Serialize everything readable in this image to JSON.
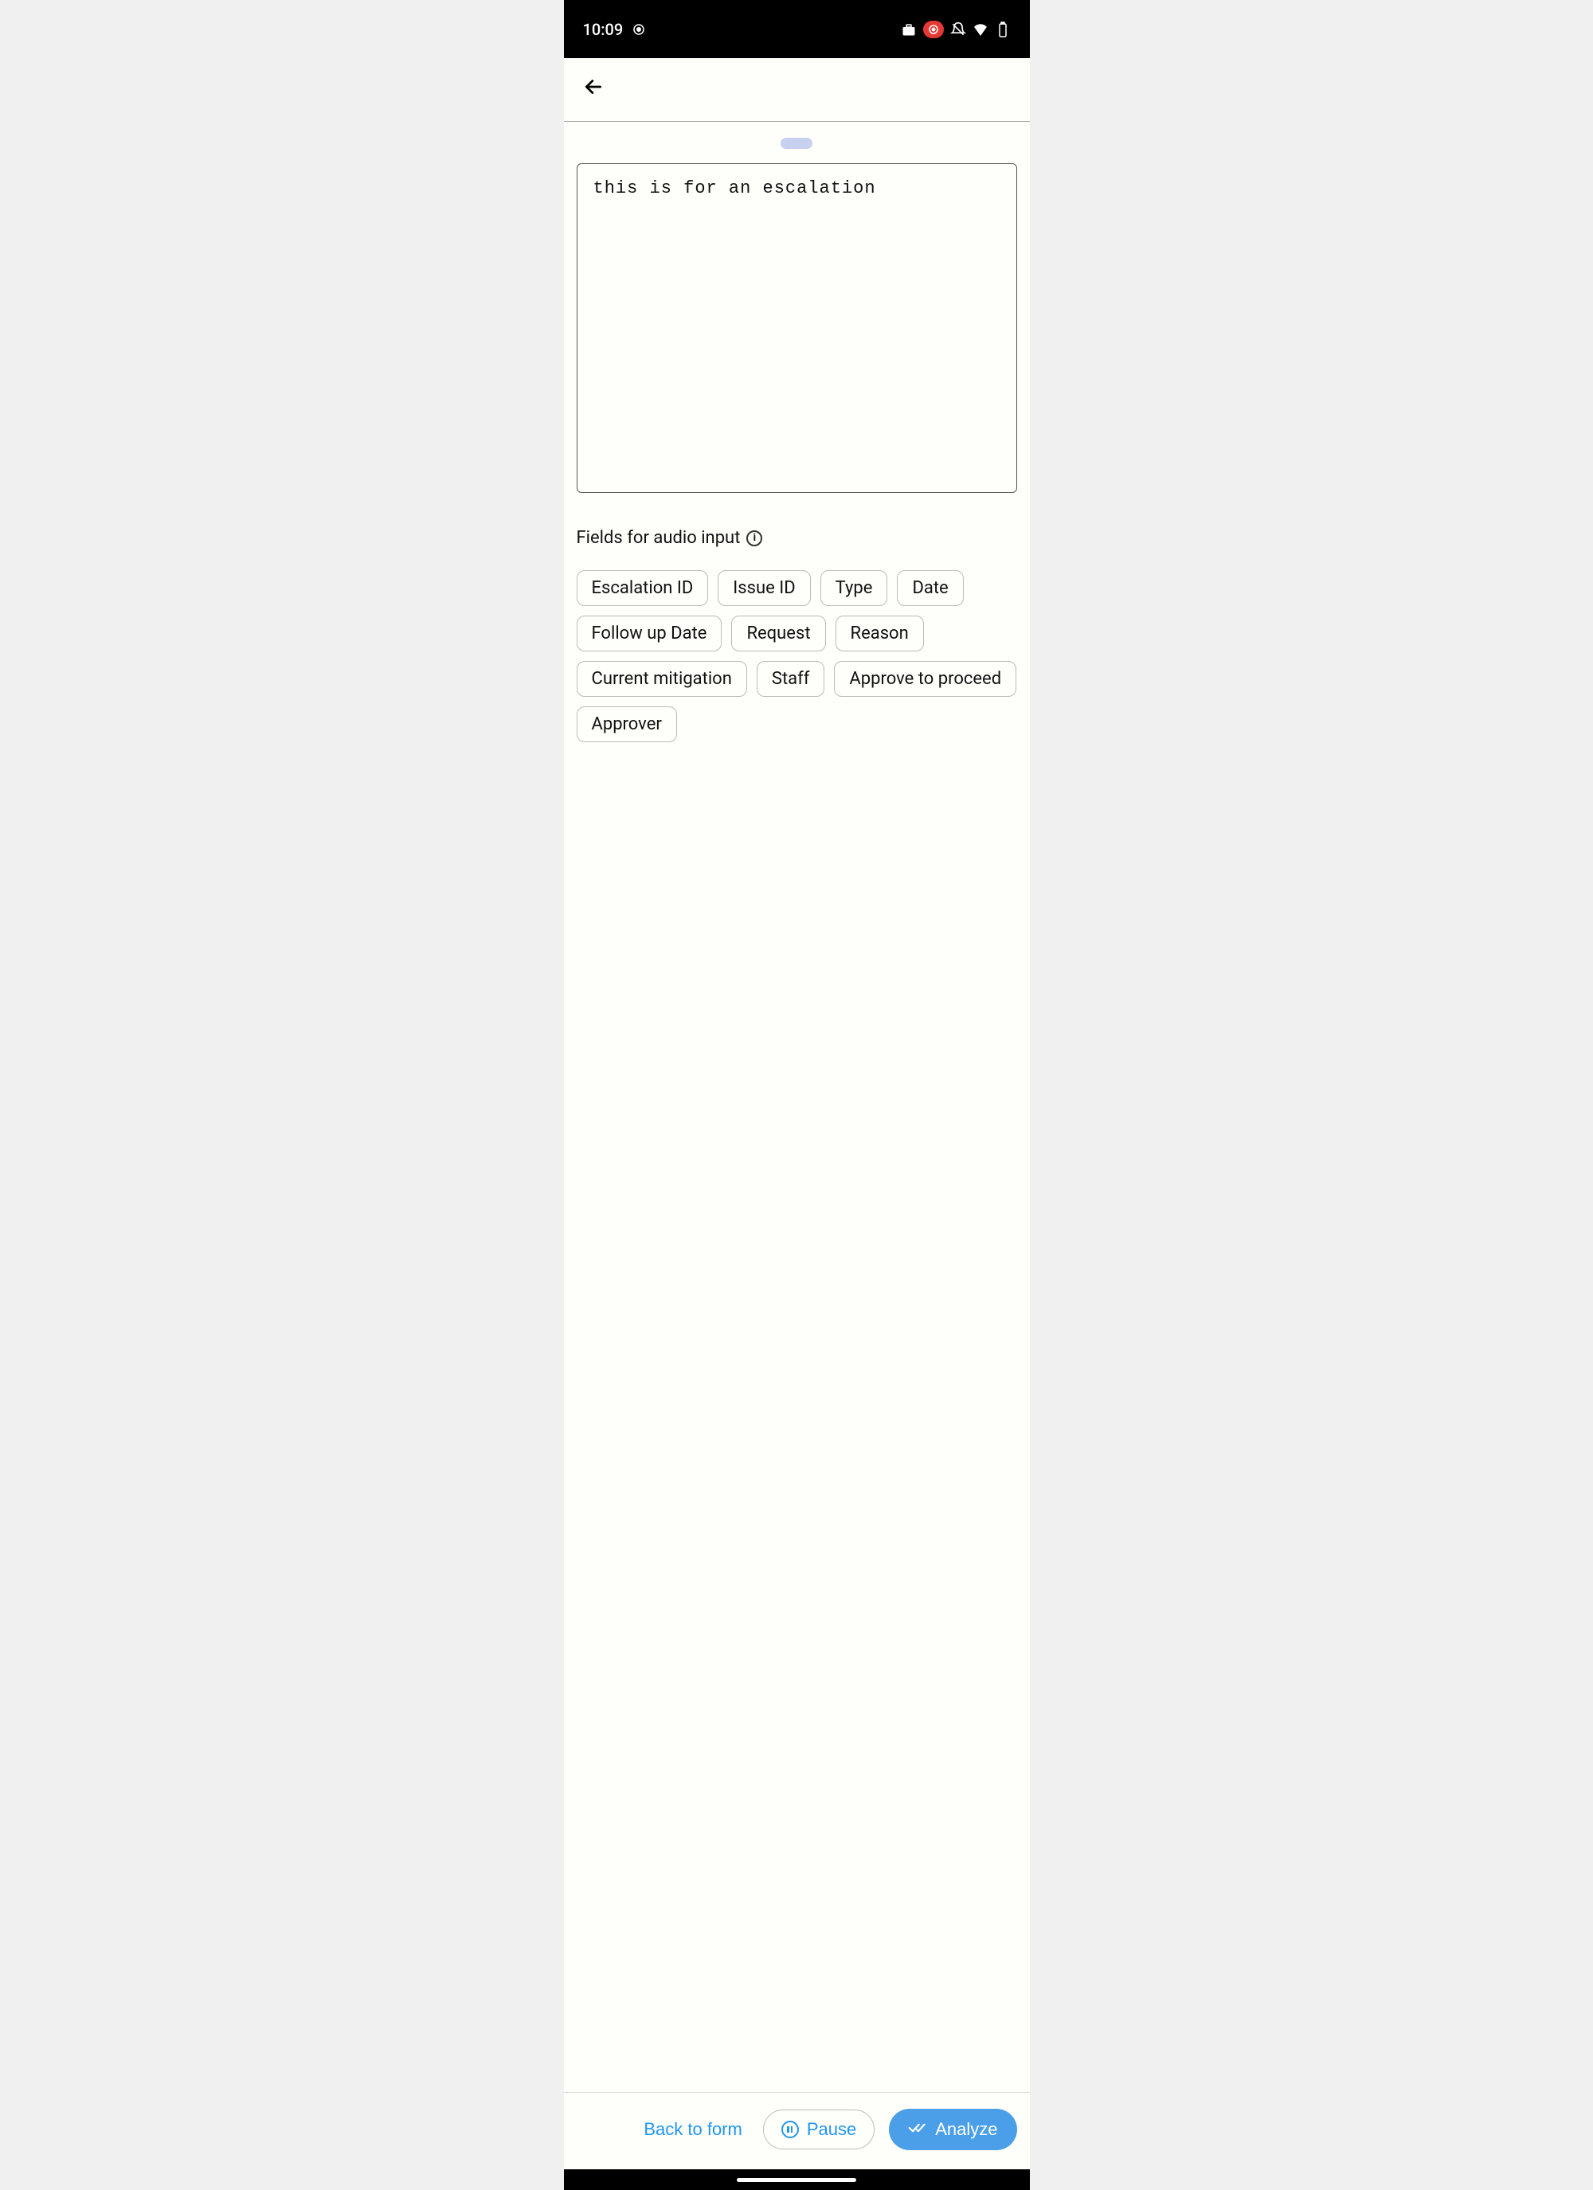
{
  "status": {
    "time": "10:09"
  },
  "text_input": {
    "value": "this is for an escalation"
  },
  "fields": {
    "label": "Fields for audio input",
    "chips": [
      "Escalation ID",
      "Issue ID",
      "Type",
      "Date",
      "Follow up Date",
      "Request",
      "Reason",
      "Current mitigation",
      "Staff",
      "Approve to proceed",
      "Approver"
    ]
  },
  "bottom": {
    "back": "Back to form",
    "pause": "Pause",
    "analyze": "Analyze"
  }
}
